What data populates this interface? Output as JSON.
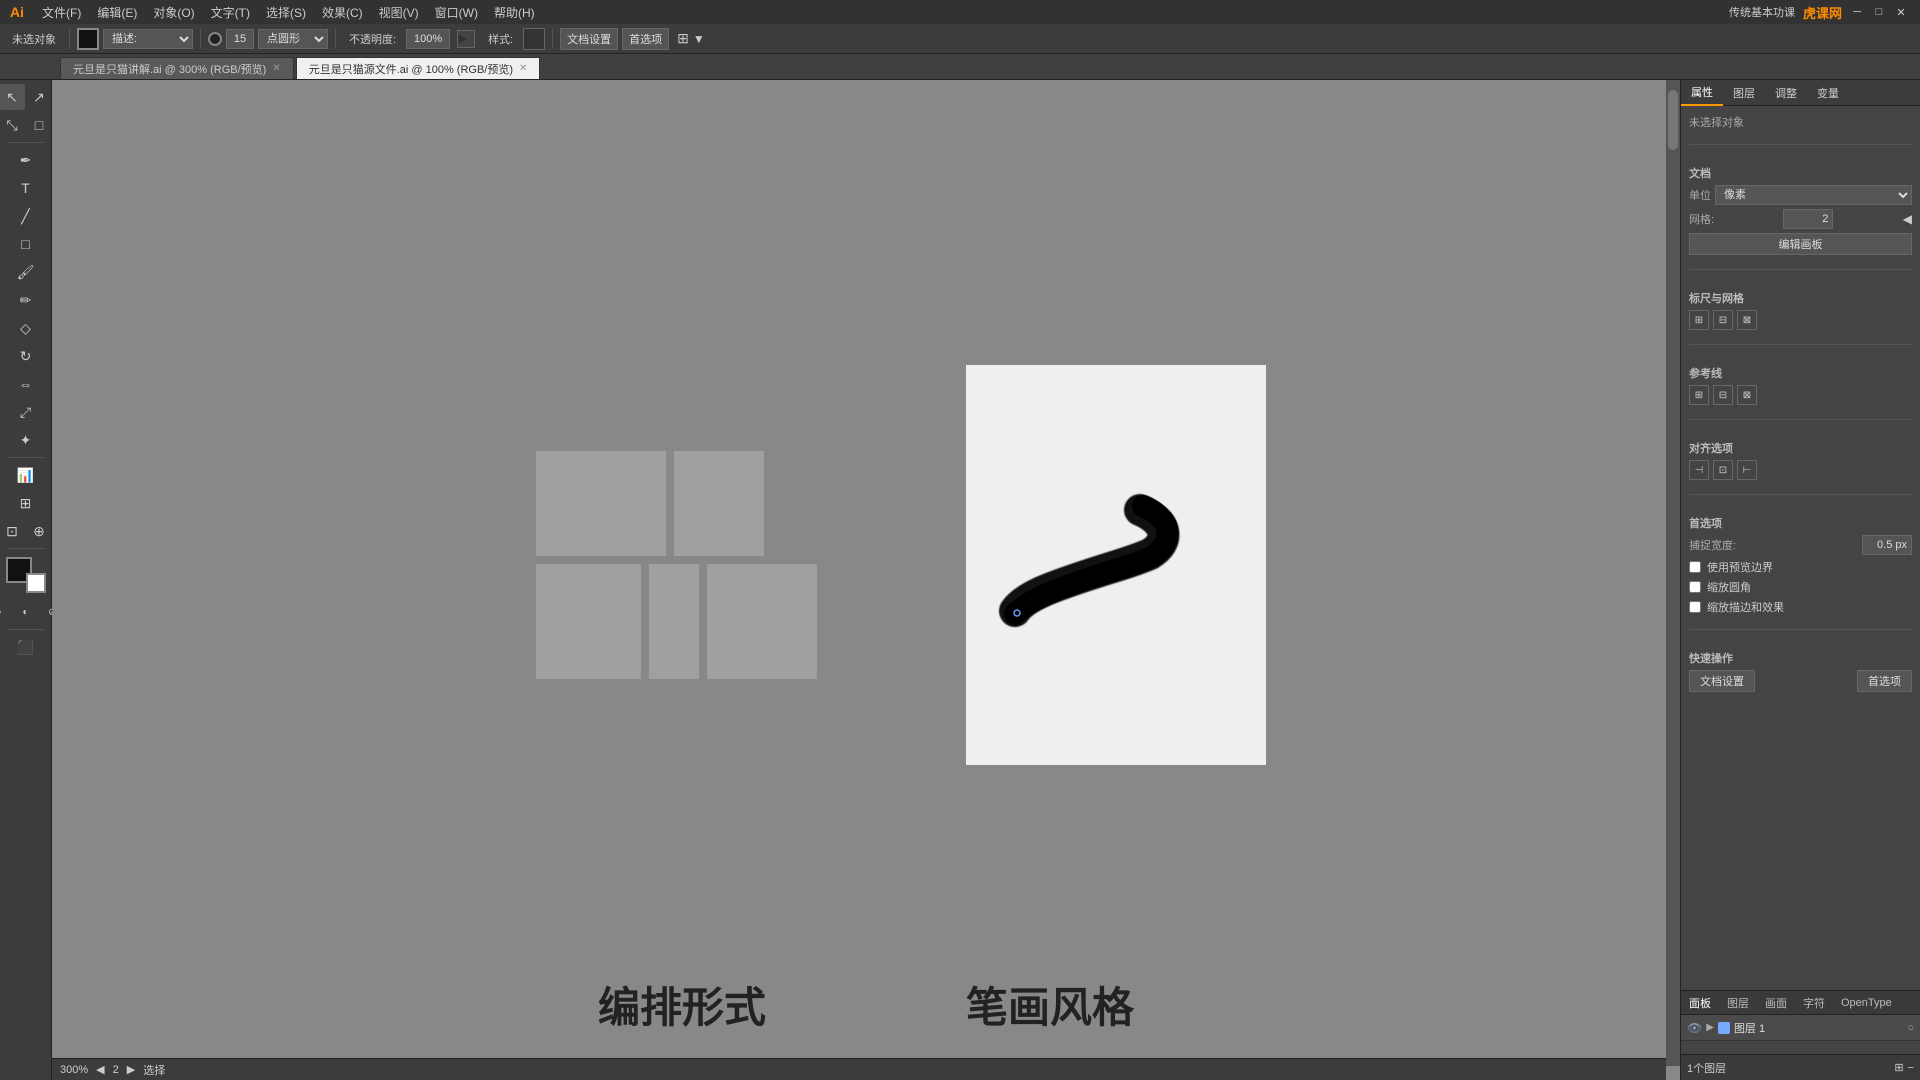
{
  "app": {
    "logo": "Ai",
    "menu_items": [
      "文件(F)",
      "编辑(E)",
      "对象(O)",
      "文字(T)",
      "选择(S)",
      "效果(C)",
      "视图(V)",
      "窗口(W)",
      "帮助(H)"
    ],
    "window_title": "传统基本功课",
    "brand": "虎课网"
  },
  "toolbar": {
    "tool_label": "未选对象",
    "stroke_size": "15",
    "stroke_shape": "点圆形",
    "opacity_label": "不透明度:",
    "opacity_value": "100%",
    "style_label": "样式:",
    "doc_settings": "文档设置",
    "preferences": "首选项"
  },
  "tabs": [
    {
      "name": "元旦是只猫讲解.ai @ 300% (RGB/预览)",
      "active": false
    },
    {
      "name": "元旦是只猫源文件.ai @ 100% (RGB/预览)",
      "active": true
    }
  ],
  "left_panel": {
    "label1": "编排形式",
    "label2": "笔画风格"
  },
  "right_panel": {
    "tabs": [
      "属性",
      "图层",
      "调整",
      "变量"
    ],
    "active_tab": "属性",
    "no_selection": "未选择对象",
    "doc_section": "文档",
    "unit_label": "单位",
    "unit_value": "像素",
    "grid_label": "网格:",
    "grid_value": "2",
    "edit_artboard_btn": "编辑画板",
    "rulers_section": "标尺与网格",
    "refs_section": "参考线",
    "align_section": "对齐选项",
    "selection_section": "首选项",
    "snap_width_label": "捕捉宽度:",
    "snap_width_value": "0.5 px",
    "use_preview": "使用预览边界",
    "scale_corners": "缩放圆角",
    "scale_stroke": "缩放描边和效果",
    "quick_ops": "快速操作",
    "doc_settings_btn": "文档设置",
    "prefs_btn": "首选项"
  },
  "layers_panel": {
    "tabs": [
      "面板",
      "图层",
      "画面",
      "字符",
      "OpenType"
    ],
    "active_tab": "图层",
    "layer1": {
      "name": "图层 1",
      "visible": true,
      "locked": false
    }
  },
  "bottom_bar": {
    "zoom": "300%",
    "page_info": "1个图层",
    "status": "选择"
  }
}
